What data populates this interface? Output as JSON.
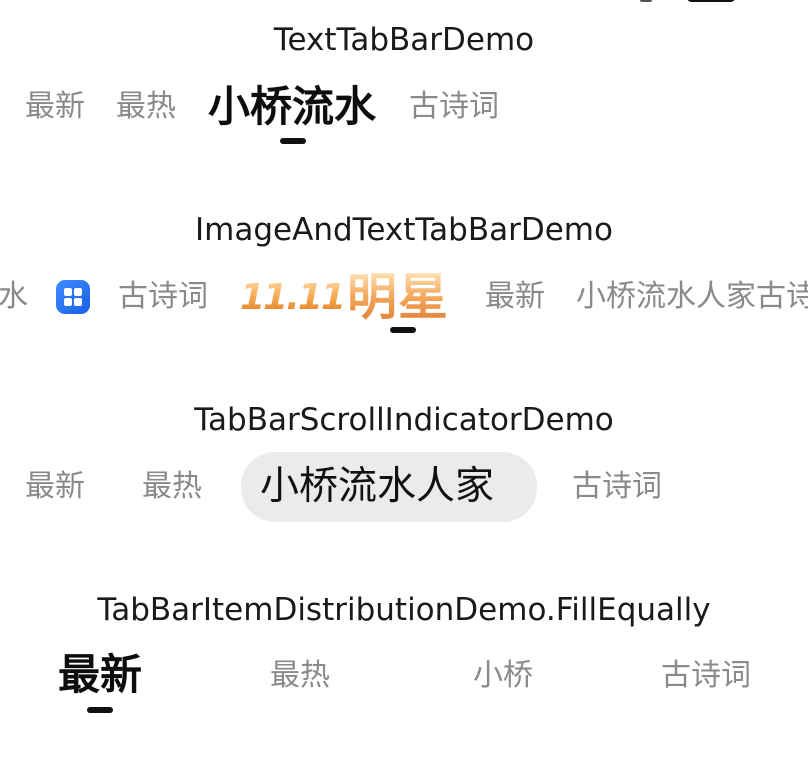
{
  "sections": [
    {
      "title": "TextTabBarDemo",
      "tabs": [
        "最新",
        "最热",
        "小桥流水",
        "古诗词"
      ]
    },
    {
      "title": "ImageAndTextTabBarDemo",
      "tabs": [
        "水",
        "grid-app-icon",
        "古诗词",
        "11.11",
        "明星",
        "最新",
        "小桥流水人家古诗"
      ],
      "promo_1111": "11.11",
      "promo_star": "明星"
    },
    {
      "title": "TabBarScrollIndicatorDemo",
      "tabs": [
        "最新",
        "最热",
        "小桥流水人家",
        "古诗词"
      ]
    },
    {
      "title": "TabBarItemDistributionDemo.FillEqually",
      "tabs": [
        "最新",
        "最热",
        "小桥",
        "古诗词"
      ]
    }
  ],
  "colors": {
    "active_text": "#0d0d0d",
    "inactive_text": "#8a8a8a",
    "indicator": "#111111",
    "pill_bg": "#ebebeb",
    "icon_blue": "#2a72f2",
    "promo_orange": "#f0a04f"
  }
}
